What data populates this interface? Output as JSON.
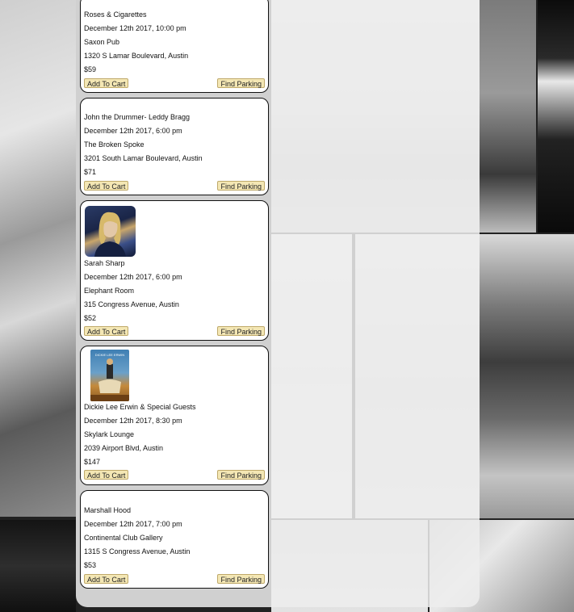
{
  "events": [
    {
      "artist": "Roses & Cigarettes",
      "date": "December 12th 2017, 10:00 pm",
      "venue": "Saxon Pub",
      "address": "1320 S Lamar Boulevard, Austin",
      "price": "$59"
    },
    {
      "artist": "John the Drummer- Leddy Bragg",
      "date": "December 12th 2017, 6:00 pm",
      "venue": "The Broken Spoke",
      "address": "3201 South Lamar Boulevard, Austin",
      "price": "$71"
    },
    {
      "artist": "Sarah Sharp",
      "date": "December 12th 2017, 6:00 pm",
      "venue": "Elephant Room",
      "address": "315 Congress Avenue, Austin",
      "price": "$52"
    },
    {
      "artist": "Dickie Lee Erwin & Special Guests",
      "date": "December 12th 2017, 8:30 pm",
      "venue": "Skylark Lounge",
      "address": "2039 Airport Blvd, Austin",
      "price": "$147"
    },
    {
      "artist": "Marshall Hood",
      "date": "December 12th 2017, 7:00 pm",
      "venue": "Continental Club Gallery",
      "address": "1315 S Congress Avenue, Austin",
      "price": "$53"
    }
  ],
  "buttons": {
    "add_to_cart": "Add To Cart",
    "find_parking": "Find Parking"
  },
  "poster_text": "DICKIE LEE ERWIN",
  "colors": {
    "button_bg": "#f4e7b4",
    "card_bg": "#ffffff",
    "card_border": "#111111"
  }
}
